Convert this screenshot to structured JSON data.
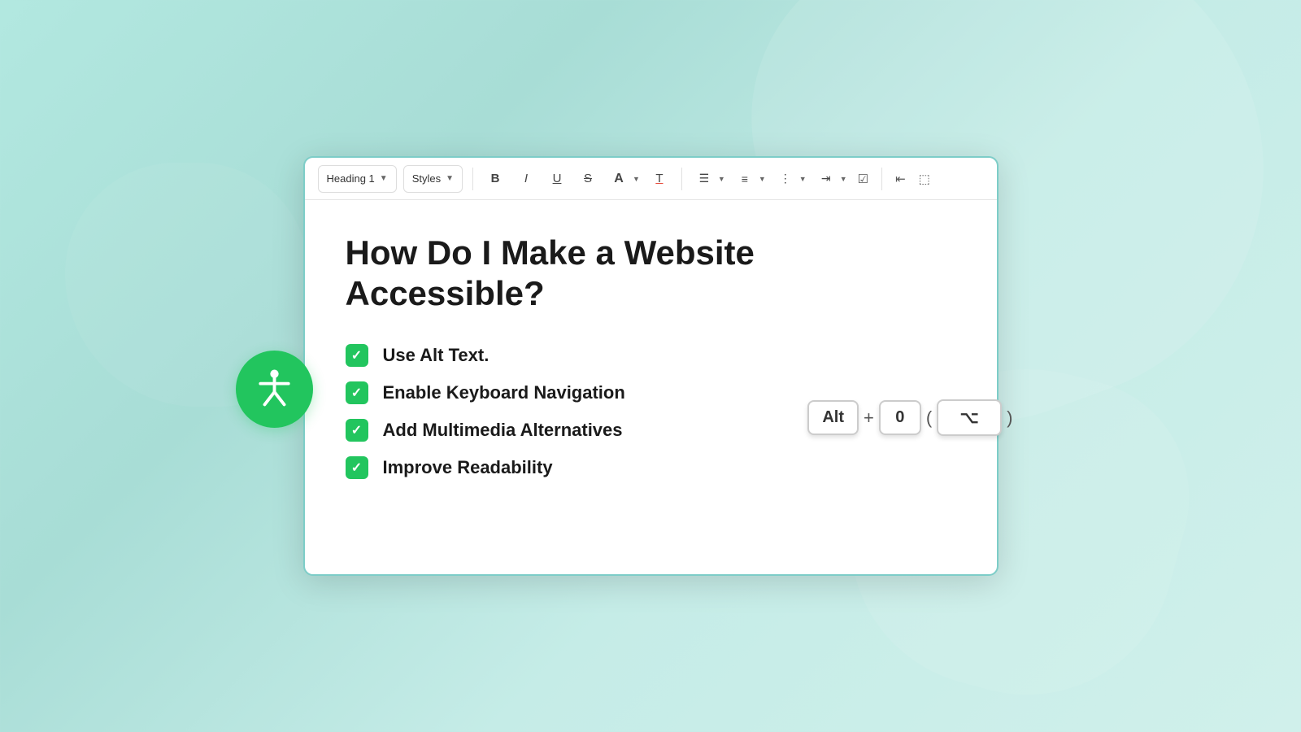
{
  "background": {
    "color_start": "#b2e8e0",
    "color_end": "#d0f0eb"
  },
  "toolbar": {
    "heading_select": "Heading 1",
    "styles_select": "Styles",
    "bold_label": "B",
    "italic_label": "I",
    "underline_label": "U",
    "strikethrough_label": "S",
    "font_size_label": "A",
    "font_color_label": "T"
  },
  "editor": {
    "heading": "How Do I Make a Website Accessible?",
    "checklist": [
      "Use Alt Text.",
      "Enable Keyboard Navigation",
      "Add Multimedia Alternatives",
      "Improve Readability"
    ]
  },
  "keyboard_shortcut": {
    "key1": "Alt",
    "plus": "+",
    "key2": "0",
    "open_paren": "(",
    "key3": "⌥",
    "close_paren": ")"
  },
  "accessibility_icon": {
    "aria_label": "Accessibility person icon"
  }
}
